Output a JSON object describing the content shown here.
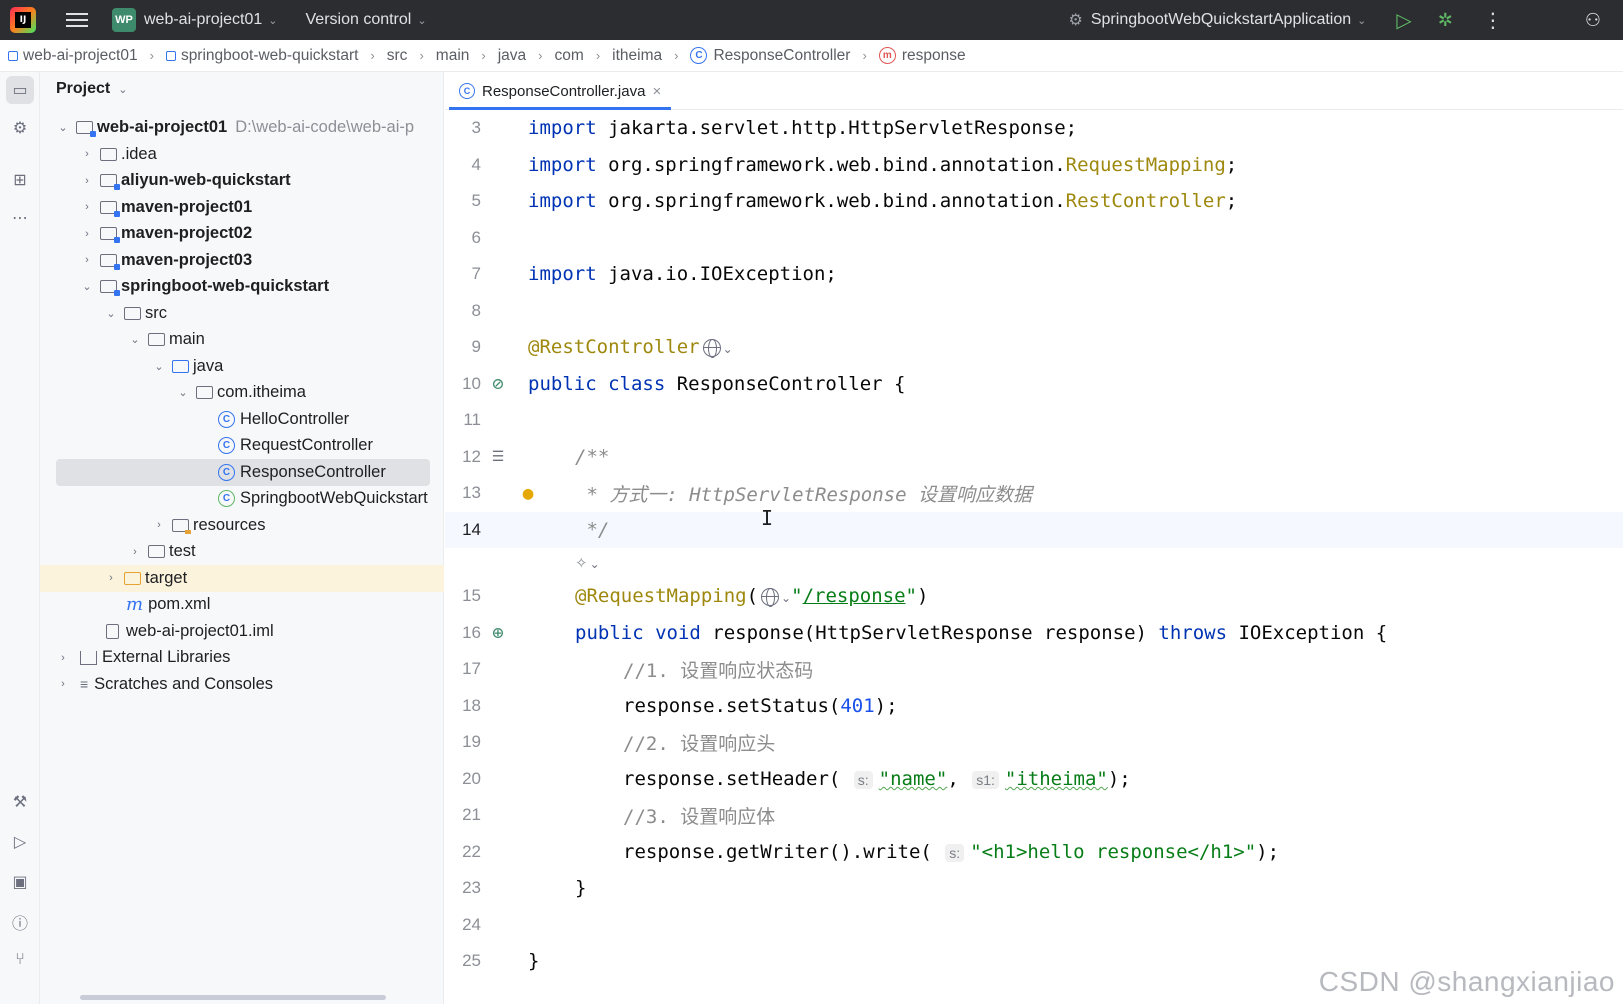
{
  "titlebar": {
    "project_badge": "WP",
    "project_name": "web-ai-project01",
    "version_control": "Version control",
    "run_config": "SpringbootWebQuickstartApplication"
  },
  "breadcrumb": [
    "web-ai-project01",
    "springboot-web-quickstart",
    "src",
    "main",
    "java",
    "com",
    "itheima",
    "ResponseController",
    "response"
  ],
  "project_panel": {
    "title": "Project",
    "tree": [
      {
        "label": "web-ai-project01",
        "path": "D:\\web-ai-code\\web-ai-p"
      },
      {
        "label": ".idea"
      },
      {
        "label": "aliyun-web-quickstart"
      },
      {
        "label": "maven-project01"
      },
      {
        "label": "maven-project02"
      },
      {
        "label": "maven-project03"
      },
      {
        "label": "springboot-web-quickstart"
      },
      {
        "label": "src"
      },
      {
        "label": "main"
      },
      {
        "label": "java"
      },
      {
        "label": "com.itheima"
      },
      {
        "label": "HelloController"
      },
      {
        "label": "RequestController"
      },
      {
        "label": "ResponseController"
      },
      {
        "label": "SpringbootWebQuickstart"
      },
      {
        "label": "resources"
      },
      {
        "label": "test"
      },
      {
        "label": "target"
      },
      {
        "label": "pom.xml"
      },
      {
        "label": "web-ai-project01.iml"
      },
      {
        "label": "External Libraries"
      },
      {
        "label": "Scratches and Consoles"
      }
    ]
  },
  "editor": {
    "tab_label": "ResponseController.java",
    "line_numbers": [
      "3",
      "4",
      "5",
      "6",
      "7",
      "8",
      "9",
      "10",
      "11",
      "12",
      "13",
      "14",
      "",
      "15",
      "16",
      "17",
      "18",
      "19",
      "20",
      "21",
      "22",
      "23",
      "24",
      "25"
    ],
    "code": {
      "l3_kw": "import",
      "l3_rest": " jakarta.servlet.http.HttpServletResponse;",
      "l4_kw": "import",
      "l4_pre": " org.springframework.web.bind.annotation.",
      "l4_ann": "RequestMapping",
      "l4_end": ";",
      "l5_kw": "import",
      "l5_pre": " org.springframework.web.bind.annotation.",
      "l5_ann": "RestController",
      "l5_end": ";",
      "l7_kw": "import",
      "l7_rest": " java.io.IOException;",
      "l9_ann": "@RestController",
      "l10_kw": "public class",
      "l10_rest": " ResponseController {",
      "l12": "/**",
      "l13_a": " * 方式一: ",
      "l13_b": "HttpServletResponse",
      "l13_c": " 设置响应数据",
      "l14": " */",
      "l15_ann": "@RequestMapping",
      "l15_open": "(",
      "l15_q1": "\"",
      "l15_path": "/response",
      "l15_q2": "\"",
      "l15_close": ")",
      "l16_kw1": "public void",
      "l16_mid": " response(HttpServletResponse response) ",
      "l16_kw2": "throws",
      "l16_end": " IOException {",
      "l17": "//1. 设置响应状态码",
      "l18_a": "response.setStatus(",
      "l18_num": "401",
      "l18_b": ");",
      "l19": "//2. 设置响应头",
      "l20_a": "response.setHeader( ",
      "l20_hint1": "s:",
      "l20_str1": "\"name\"",
      "l20_comma": ", ",
      "l20_hint2": "s1:",
      "l20_str2": "\"itheima\"",
      "l20_end": ");",
      "l21": "//3. 设置响应体",
      "l22_a": "response.getWriter().write( ",
      "l22_hint": "s:",
      "l22_str": "\"<h1>hello response</h1>\"",
      "l22_end": ");",
      "l23": "}",
      "l25": "}"
    }
  },
  "watermark": "CSDN @shangxianjiao"
}
